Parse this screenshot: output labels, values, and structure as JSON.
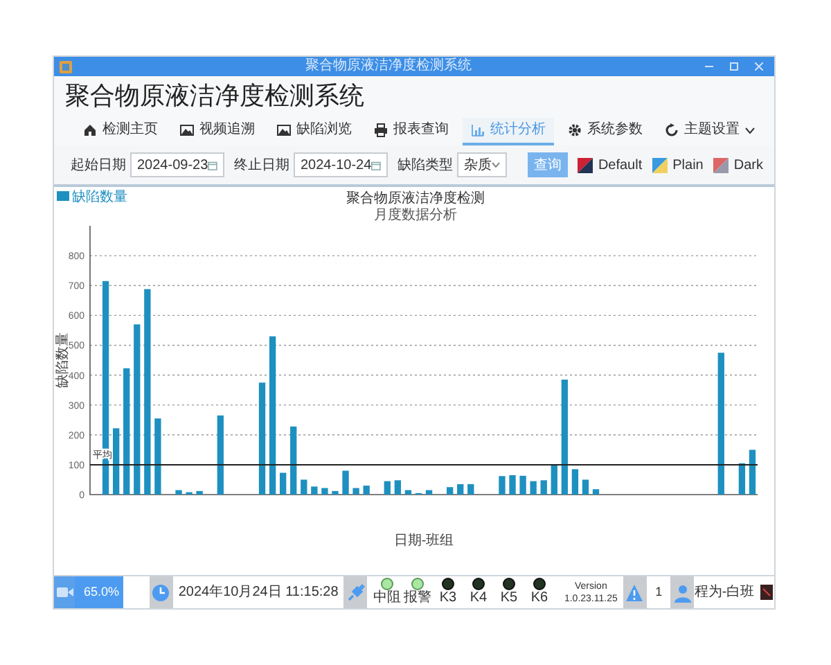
{
  "window": {
    "title": "聚合物原液洁净度检测系统"
  },
  "header": {
    "title": "聚合物原液洁净度检测系统"
  },
  "nav": [
    {
      "label": "检测主页",
      "selected": false,
      "dropdown": false
    },
    {
      "label": "视频追溯",
      "selected": false,
      "dropdown": false
    },
    {
      "label": "缺陷浏览",
      "selected": false,
      "dropdown": false
    },
    {
      "label": "报表查询",
      "selected": false,
      "dropdown": false
    },
    {
      "label": "统计分析",
      "selected": true,
      "dropdown": false
    },
    {
      "label": "系统参数",
      "selected": false,
      "dropdown": false
    },
    {
      "label": "主题设置",
      "selected": false,
      "dropdown": true
    }
  ],
  "toolbar": {
    "start_label": "起始日期",
    "start_date": "2024-09-23",
    "end_label": "终止日期",
    "end_date": "2024-10-24",
    "type_label": "缺陷类型",
    "type_value": "杂质",
    "query_button": "查询"
  },
  "themes": [
    {
      "label": "Default"
    },
    {
      "label": "Plain"
    },
    {
      "label": "Dark"
    }
  ],
  "chart": {
    "subtitle": "月度数据分析",
    "chart_data": {
      "type": "bar",
      "title": "聚合物原液洁净度检测",
      "xlabel": "日期-班组",
      "ylabel": "缺陷数量",
      "ylim": [
        0,
        900
      ],
      "grid": true,
      "yticks": [
        0,
        100,
        200,
        300,
        400,
        500,
        600,
        700,
        800
      ],
      "series": [
        {
          "name": "缺陷数量",
          "color": "#1e90c0",
          "values": [
            0,
            715,
            222,
            423,
            570,
            688,
            255,
            0,
            15,
            8,
            12,
            0,
            265,
            0,
            0,
            0,
            375,
            530,
            73,
            228,
            50,
            27,
            22,
            12,
            80,
            22,
            30,
            0,
            45,
            48,
            15,
            5,
            15,
            0,
            25,
            35,
            35,
            0,
            0,
            62,
            65,
            63,
            45,
            48,
            100,
            385,
            85,
            50,
            18,
            0,
            0,
            0,
            0,
            0,
            0,
            0,
            0,
            0,
            0,
            0,
            475,
            0,
            105,
            150
          ]
        }
      ],
      "ref_lines": [
        {
          "axis": "y",
          "value": 100,
          "label": "平均"
        }
      ]
    }
  },
  "status": {
    "progress": {
      "level": 0.65,
      "reading": "65.0%"
    },
    "datetime": "2024年10月24日 11:15:28",
    "lamps": [
      {
        "label": "中阻",
        "on": true
      },
      {
        "label": "报警",
        "on": true
      },
      {
        "label": "K3",
        "on": false
      },
      {
        "label": "K4",
        "on": false
      },
      {
        "label": "K5",
        "on": false
      },
      {
        "label": "K6",
        "on": false
      }
    ],
    "version_label": "Version",
    "version": "1.0.23.11.25",
    "alert_count": "1",
    "user": "程为-白班"
  }
}
